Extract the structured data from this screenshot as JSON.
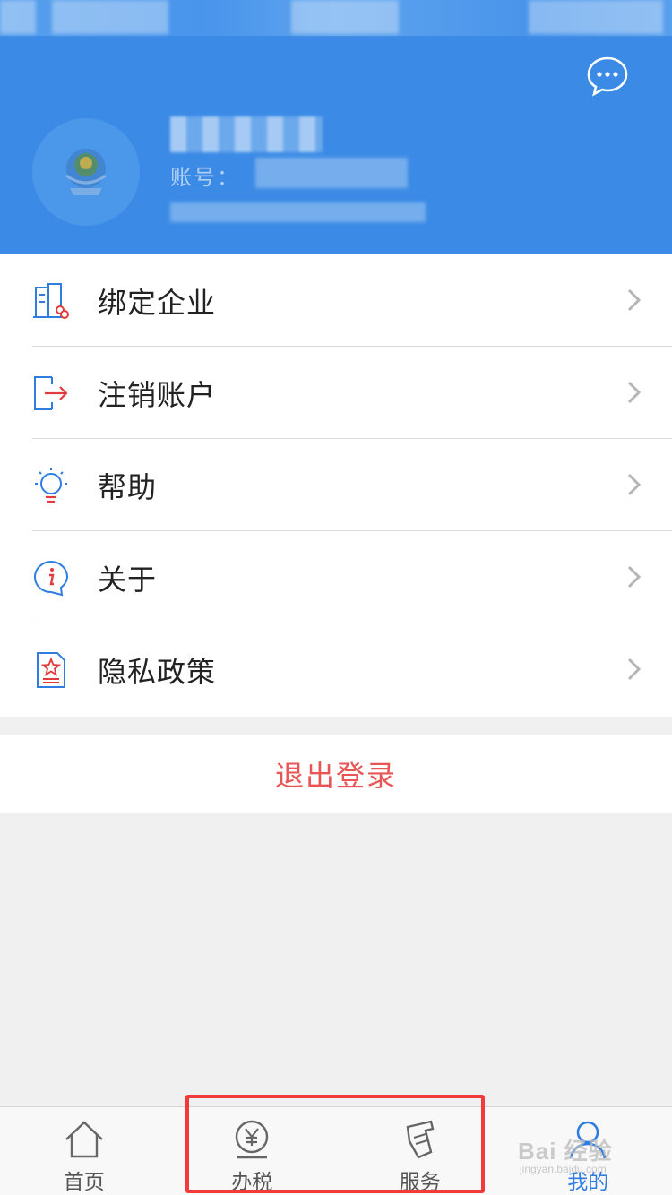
{
  "header": {
    "account_label": "账号：",
    "message_icon": "chat-bubble-icon",
    "avatar_icon": "tax-emblem-icon",
    "background": "#3b8be6"
  },
  "menu": {
    "items": [
      {
        "label": "绑定企业",
        "icon": "building-link-icon"
      },
      {
        "label": "注销账户",
        "icon": "exit-arrow-icon"
      },
      {
        "label": "帮助",
        "icon": "lightbulb-icon"
      },
      {
        "label": "关于",
        "icon": "info-icon"
      },
      {
        "label": "隐私政策",
        "icon": "document-star-icon"
      }
    ]
  },
  "logout": {
    "label": "退出登录",
    "color": "#e95555"
  },
  "tabbar": {
    "tabs": [
      {
        "label": "首页",
        "icon": "home-icon",
        "active": false
      },
      {
        "label": "办税",
        "icon": "yen-coin-icon",
        "active": false
      },
      {
        "label": "服务",
        "icon": "service-tag-icon",
        "active": false
      },
      {
        "label": "我的",
        "icon": "user-icon",
        "active": true
      }
    ],
    "active_color": "#2f7de1"
  },
  "watermark": {
    "text": "Bai 经验",
    "sub": "jingyan.baidu.com"
  },
  "colors": {
    "accent": "#3b8be6",
    "highlight": "#f13a3a",
    "danger": "#e95555"
  }
}
